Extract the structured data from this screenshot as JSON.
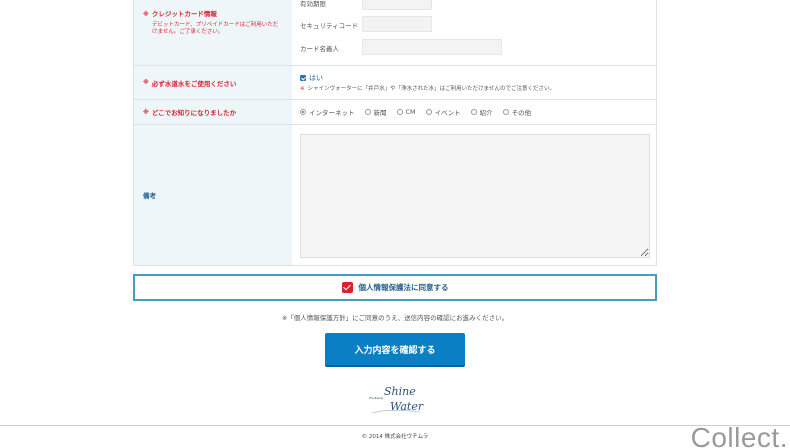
{
  "card": {
    "label": "クレジットカード情報",
    "note": "デビットカード、プリペイドカードはご利用いただけません。ご了承ください。",
    "expiry_label": "有効期限",
    "security_label": "セキュリティコード",
    "holder_label": "カード名義人"
  },
  "water": {
    "label": "必ず水道水をご使用ください",
    "yes_label": "はい",
    "warning": "シャインウォーターに「井戸水」や「浄水された水」はご利用いただけませんのでご注意ください。"
  },
  "how": {
    "label": "どこでお知りになりましたか",
    "options": [
      "インターネット",
      "新聞",
      "CM",
      "イベント",
      "紹介",
      "その他"
    ],
    "selected": "インターネット"
  },
  "note": {
    "label": "備考"
  },
  "required_mark": "※",
  "consent": {
    "label": "個人情報保護法に同意する"
  },
  "notice": "※「個人情報保護方針」にご同意のうえ、送信内容の確認にお進みください。",
  "submit_label": "入力内容を確認する",
  "logo": {
    "line1": "Shine",
    "line2": "Water",
    "small": "The Beauty"
  },
  "copyright": "© 2014 株式会社ウチムラ",
  "watermark": "Collect."
}
